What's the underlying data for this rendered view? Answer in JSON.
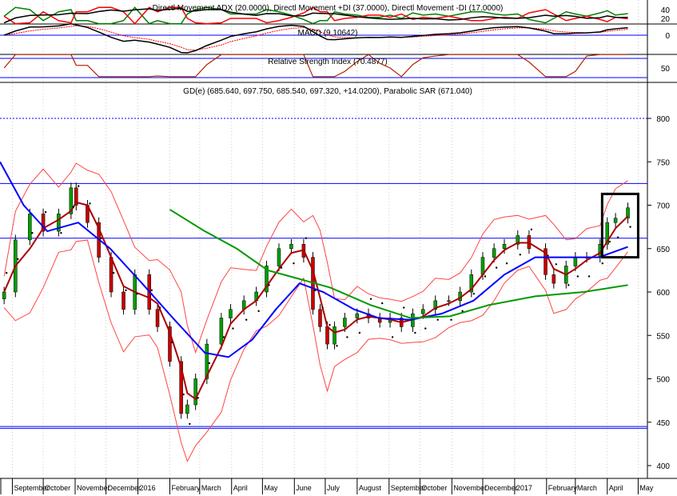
{
  "chart_data": {
    "type": "line",
    "panels": {
      "dmi": {
        "title": "Directl Movement ADX (20.0000), Directl Movement +DI (37.0000), Directl Movement -DI (17.0000)",
        "ticks": [
          40,
          20
        ],
        "colors": {
          "adx": "#000000",
          "plus_di": "#008000",
          "minus_di": "#ff0000"
        }
      },
      "macd": {
        "title": "MACD (9.10642)",
        "ticks": [
          0
        ],
        "colors": {
          "macd": "#000000",
          "signal": "#ff0000",
          "zero": "#0000ff"
        }
      },
      "rsi": {
        "title": "Relative Strength Index (70.4877)",
        "ticks": [
          50
        ],
        "levels": [
          70,
          30
        ],
        "colors": {
          "rsi": "#b22200",
          "levels": "#0000ff"
        }
      },
      "price": {
        "title": "GD(e) (685.640, 697.750, 685.540, 697.320, +14.0200), Parabolic SAR (671.040)",
        "ylim": [
          390,
          820
        ],
        "yticks": [
          800,
          750,
          700,
          650,
          600,
          550,
          500,
          450,
          400
        ],
        "xlim": [
          "2015-08-20",
          "2017-05-10"
        ],
        "hlines": [
          {
            "y": 800,
            "style": "dotted"
          },
          {
            "y": 725,
            "style": "solid"
          },
          {
            "y": 662,
            "style": "solid"
          },
          {
            "y": 445,
            "style": "solid"
          },
          {
            "y": 443,
            "style": "solid"
          }
        ],
        "box": {
          "x": [
            "2017-03-27",
            "2017-05-01"
          ],
          "y": [
            640,
            713
          ]
        },
        "colors": {
          "up": "#00a000",
          "down": "#cc0000",
          "ma_short": "#aa0000",
          "ma_mid": "#0000ff",
          "ma_long": "#009900",
          "bands": "#ff4444",
          "sar": "#000000",
          "hline": "#0000ff"
        }
      }
    },
    "x_ticks": [
      {
        "label": "September",
        "date": "2015-09-01"
      },
      {
        "label": "October",
        "date": "2015-10-01"
      },
      {
        "label": "November",
        "date": "2015-11-01"
      },
      {
        "label": "December",
        "date": "2015-12-01"
      },
      {
        "label": "2016",
        "date": "2016-01-01"
      },
      {
        "label": "February",
        "date": "2016-02-01"
      },
      {
        "label": "March",
        "date": "2016-03-01"
      },
      {
        "label": "April",
        "date": "2016-04-01"
      },
      {
        "label": "May",
        "date": "2016-05-01"
      },
      {
        "label": "June",
        "date": "2016-06-01"
      },
      {
        "label": "July",
        "date": "2016-07-01"
      },
      {
        "label": "August",
        "date": "2016-08-01"
      },
      {
        "label": "September",
        "date": "2016-09-01"
      },
      {
        "label": "October",
        "date": "2016-10-01"
      },
      {
        "label": "November",
        "date": "2016-11-01"
      },
      {
        "label": "December",
        "date": "2016-12-01"
      },
      {
        "label": "2017",
        "date": "2017-01-01"
      },
      {
        "label": "February",
        "date": "2017-02-01"
      },
      {
        "label": "March",
        "date": "2017-03-01"
      },
      {
        "label": "April",
        "date": "2017-04-01"
      },
      {
        "label": "May",
        "date": "2017-05-01"
      }
    ],
    "close": {
      "dates": [
        "2015-08-24",
        "2015-09-04",
        "2015-09-18",
        "2015-10-01",
        "2015-10-16",
        "2015-10-28",
        "2015-11-02",
        "2015-11-13",
        "2015-11-24",
        "2015-12-06",
        "2015-12-18",
        "2015-12-29",
        "2016-01-12",
        "2016-01-20",
        "2016-02-01",
        "2016-02-12",
        "2016-02-18",
        "2016-02-26",
        "2016-03-08",
        "2016-03-22",
        "2016-03-31",
        "2016-04-13",
        "2016-04-25",
        "2016-05-05",
        "2016-05-17",
        "2016-05-29",
        "2016-06-10",
        "2016-06-19",
        "2016-06-26",
        "2016-07-03",
        "2016-07-10",
        "2016-07-20",
        "2016-08-01",
        "2016-08-12",
        "2016-08-23",
        "2016-09-02",
        "2016-09-13",
        "2016-09-24",
        "2016-10-04",
        "2016-10-16",
        "2016-10-29",
        "2016-11-09",
        "2016-11-20",
        "2016-12-01",
        "2016-12-12",
        "2016-12-22",
        "2017-01-04",
        "2017-01-15",
        "2017-01-31",
        "2017-02-08",
        "2017-02-20",
        "2017-03-01",
        "2017-03-12",
        "2017-03-25",
        "2017-04-01",
        "2017-04-09",
        "2017-04-21"
      ],
      "values": [
        600,
        660,
        690,
        670,
        690,
        720,
        700,
        680,
        640,
        600,
        580,
        620,
        580,
        560,
        520,
        460,
        470,
        500,
        540,
        570,
        580,
        590,
        600,
        630,
        650,
        655,
        640,
        580,
        560,
        540,
        560,
        570,
        575,
        570,
        565,
        570,
        560,
        575,
        580,
        590,
        590,
        600,
        620,
        640,
        650,
        655,
        665,
        650,
        620,
        610,
        630,
        640,
        640,
        655,
        680,
        685,
        697
      ]
    },
    "ma_mid": {
      "dates": [
        "2015-08-20",
        "2015-09-12",
        "2015-10-05",
        "2015-11-04",
        "2015-12-05",
        "2016-01-05",
        "2016-02-04",
        "2016-03-06",
        "2016-03-29",
        "2016-04-21",
        "2016-05-14",
        "2016-06-06",
        "2016-06-29",
        "2016-07-29",
        "2016-08-22",
        "2016-09-22",
        "2016-10-22",
        "2016-11-22",
        "2016-12-22",
        "2017-01-21",
        "2017-02-21",
        "2017-03-24",
        "2017-04-21"
      ],
      "values": [
        750,
        700,
        670,
        680,
        650,
        610,
        570,
        530,
        525,
        545,
        580,
        610,
        600,
        580,
        570,
        568,
        575,
        590,
        620,
        640,
        640,
        640,
        652
      ]
    },
    "ma_long": {
      "dates": [
        "2016-02-01",
        "2016-03-06",
        "2016-04-06",
        "2016-05-06",
        "2016-06-06",
        "2016-07-06",
        "2016-08-14",
        "2016-09-22",
        "2016-10-30",
        "2016-12-07",
        "2017-01-21",
        "2017-03-09",
        "2017-04-21"
      ],
      "values": [
        695,
        670,
        650,
        625,
        615,
        605,
        585,
        570,
        572,
        585,
        595,
        600,
        608
      ]
    }
  }
}
